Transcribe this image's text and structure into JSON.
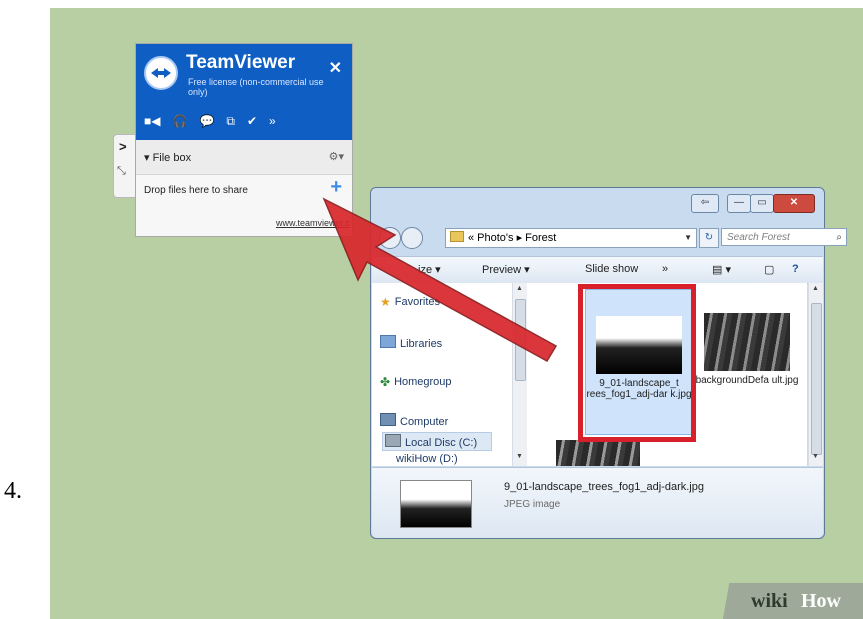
{
  "step_number": "4.",
  "teamviewer": {
    "title": "TeamViewer",
    "subtitle": "Free license (non-commercial use only)",
    "close": "✕",
    "tools": [
      "■◀",
      "🎧",
      "💬",
      "⧉",
      "✔",
      "»"
    ],
    "file_box_label": "▾ File box",
    "gear": "⚙▾",
    "drop_text": "Drop files here to share",
    "plus": "+",
    "url": "www.teamviewer.c",
    "side_chevron": ">",
    "side_expand": "⤡"
  },
  "explorer": {
    "caption_buttons": [
      "⇦",
      "—",
      "▭",
      "✕"
    ],
    "address_breadcrumb": "« Photo's ▸ Forest",
    "search_placeholder": "Search Forest",
    "toolbar": {
      "organize": "ize ▾",
      "preview": "Preview ▾",
      "slideshow": "Slide show",
      "more": "»",
      "views": "▤ ▾",
      "pane": "▢",
      "help": "?"
    },
    "nav_items": [
      {
        "label": "Favorites"
      },
      {
        "label": "Libraries"
      },
      {
        "label": "Homegroup"
      },
      {
        "label": "Computer"
      },
      {
        "label": "Local Disc (C:)"
      },
      {
        "label": "wikiHow (D:)"
      }
    ],
    "files": [
      {
        "name": "9_01-landscape_trees_fog1_adj-dark.jpg",
        "display": "9_01-landscape_t rees_fog1_adj-dar k.jpg"
      },
      {
        "name": "backgroundDefault.jpg",
        "display": "backgroundDefa ult.jpg"
      }
    ],
    "details": {
      "filename": "9_01-landscape_trees_fog1_adj-dark.jpg",
      "type": "JPEG image"
    }
  },
  "watermark": {
    "part1": "wiki",
    "part2": "How"
  },
  "colors": {
    "background": "#b8cfa3",
    "teamviewer_blue": "#0e5ec4",
    "highlight_red": "#d8202b",
    "arrow_red": "#d9262b"
  }
}
